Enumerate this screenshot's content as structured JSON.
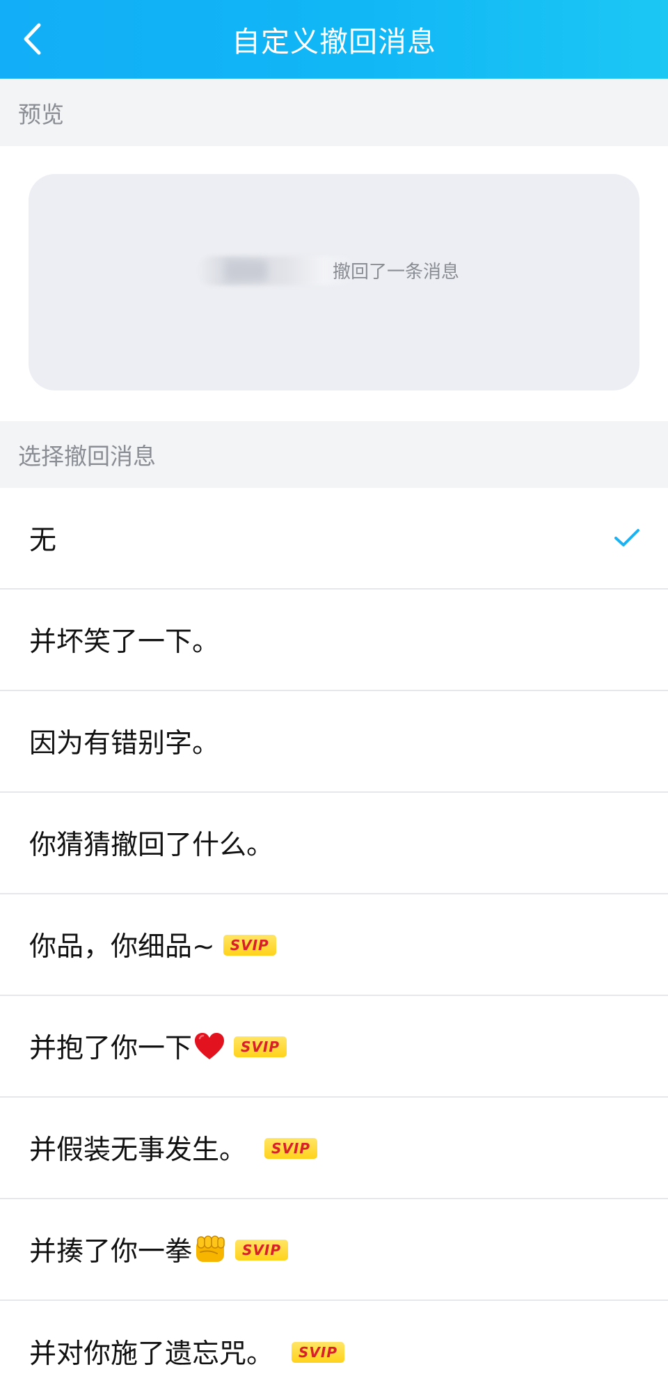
{
  "header": {
    "back_icon": "chevron-left-icon",
    "title": "自定义撤回消息",
    "color_start": "#12aef7",
    "color_end": "#1cc7f4"
  },
  "preview_section": {
    "title": "预览",
    "preview_text": "撤回了一条消息"
  },
  "select_section": {
    "title": "选择撤回消息"
  },
  "badge_label": "SVIP",
  "accent_color": "#1cb1f0",
  "options": [
    {
      "label": "无",
      "selected": true,
      "svip": false,
      "emoji": ""
    },
    {
      "label": "并坏笑了一下。",
      "selected": false,
      "svip": false,
      "emoji": ""
    },
    {
      "label": "因为有错别字。",
      "selected": false,
      "svip": false,
      "emoji": ""
    },
    {
      "label": "你猜猜撤回了什么。",
      "selected": false,
      "svip": false,
      "emoji": ""
    },
    {
      "label": "你品，你细品~",
      "selected": false,
      "svip": true,
      "emoji": ""
    },
    {
      "label": "并抱了你一下",
      "selected": false,
      "svip": true,
      "emoji": "red-heart-icon"
    },
    {
      "label": "并假装无事发生。",
      "selected": false,
      "svip": true,
      "emoji": ""
    },
    {
      "label": "并揍了你一拳",
      "selected": false,
      "svip": true,
      "emoji": "fist-icon"
    },
    {
      "label": "并对你施了遗忘咒。",
      "selected": false,
      "svip": true,
      "emoji": ""
    }
  ]
}
